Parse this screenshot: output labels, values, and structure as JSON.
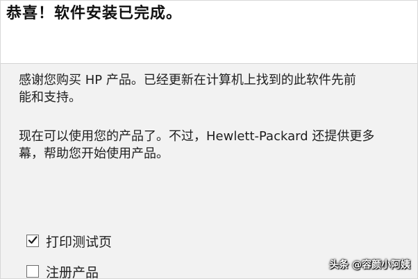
{
  "dialog": {
    "title": "恭喜！软件安装已完成。",
    "paragraph1": {
      "line1": "感谢您购买 HP 产品。已经更新在计算机上找到的此软件先前",
      "line2": "能和支持。"
    },
    "paragraph2": {
      "line1": "现在可以使用您的产品了。不过，Hewlett-Packard 还提供更多",
      "line2": "幕，帮助您开始使用产品。"
    },
    "options": [
      {
        "label": "打印测试页",
        "checked": true
      },
      {
        "label": "注册产品",
        "checked": false
      }
    ]
  },
  "watermark": {
    "text": "头条 @容颜小阿姨"
  }
}
